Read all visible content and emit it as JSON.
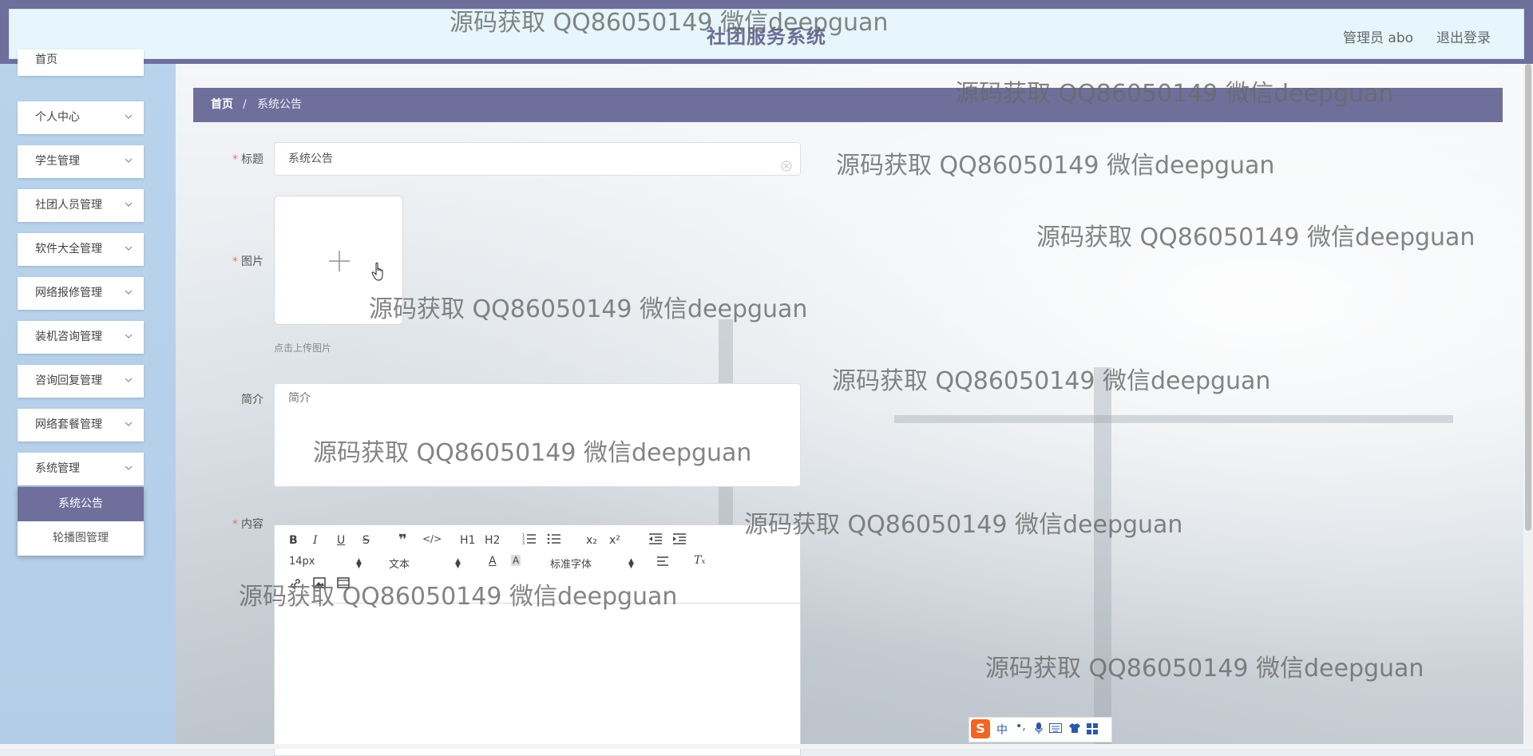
{
  "header": {
    "app_title": "社团服务系统",
    "admin_label": "管理员 abo",
    "logout": "退出登录"
  },
  "sidebar": {
    "items": [
      {
        "label": "首页"
      },
      {
        "label": "个人中心"
      },
      {
        "label": "学生管理"
      },
      {
        "label": "社团人员管理"
      },
      {
        "label": "软件大全管理"
      },
      {
        "label": "网络报修管理"
      },
      {
        "label": "装机咨询管理"
      },
      {
        "label": "咨询回复管理"
      },
      {
        "label": "网络套餐管理"
      },
      {
        "label": "系统管理"
      }
    ],
    "submenu": [
      {
        "label": "系统公告",
        "active": true
      },
      {
        "label": "轮播图管理",
        "active": false
      }
    ]
  },
  "breadcrumb": {
    "home": "首页",
    "separator": "/",
    "current": "系统公告"
  },
  "form": {
    "title_label": "标题",
    "title_value": "系统公告",
    "image_label": "图片",
    "upload_hint": "点击上传图片",
    "intro_label": "简介",
    "intro_placeholder": "简介",
    "content_label": "内容",
    "required_mark": "*"
  },
  "editor": {
    "buttons": {
      "bold": "B",
      "italic": "I",
      "underline": "U",
      "strike": "S",
      "h1": "H1",
      "h2": "H2",
      "sub": "x₂",
      "sup": "x²"
    },
    "font_size": "14px",
    "text_type": "文本",
    "font_family": "标准字体"
  },
  "watermark": "源码获取 QQ86050149 微信deepguan",
  "ime": {
    "lang": "中"
  },
  "colors": {
    "accent": "#6f6f9c",
    "header_bg": "#e6f6fc",
    "sidebar_bg": "#b9d3ec",
    "required": "#f56c6c"
  }
}
